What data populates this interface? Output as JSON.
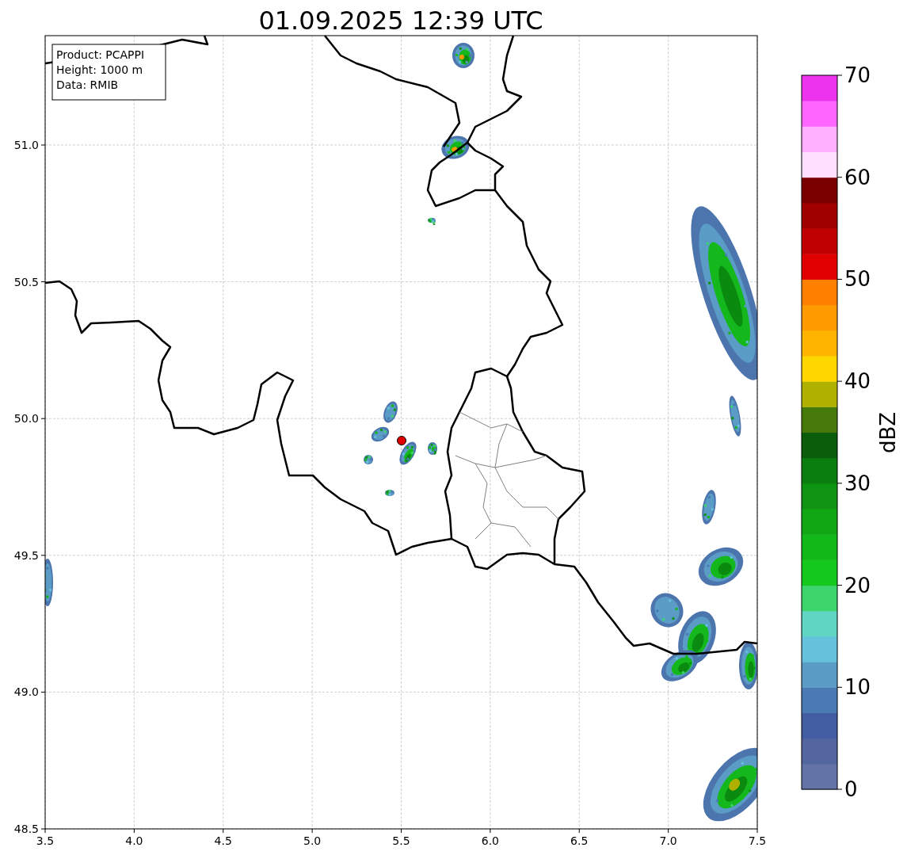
{
  "title": "01.09.2025 12:39 UTC",
  "info_box": [
    "Product: PCAPPI",
    "Height: 1000 m",
    "Data: RMIB"
  ],
  "x_ticks": [
    "3.5",
    "4.0",
    "4.5",
    "5.0",
    "5.5",
    "6.0",
    "6.5",
    "7.0",
    "7.5"
  ],
  "y_ticks": [
    "51.0",
    "50.5",
    "50.0",
    "49.5",
    "49.0",
    "48.5"
  ],
  "colorbar": {
    "label": "dBZ",
    "ticks": [
      "70",
      "60",
      "50",
      "40",
      "30",
      "20",
      "10",
      "0"
    ],
    "levels": [
      {
        "color": "#6373a6"
      },
      {
        "color": "#53669f"
      },
      {
        "color": "#425da2"
      },
      {
        "color": "#4a7ab3"
      },
      {
        "color": "#5a9cc6"
      },
      {
        "color": "#66c2dc"
      },
      {
        "color": "#5fd5c2"
      },
      {
        "color": "#3dd46c"
      },
      {
        "color": "#14c81c"
      },
      {
        "color": "#12b818"
      },
      {
        "color": "#10a614"
      },
      {
        "color": "#0e9312"
      },
      {
        "color": "#0b7e10"
      },
      {
        "color": "#095d0b"
      },
      {
        "color": "#457a0a"
      },
      {
        "color": "#b0b000"
      },
      {
        "color": "#ffd700"
      },
      {
        "color": "#ffb400"
      },
      {
        "color": "#ff9a00"
      },
      {
        "color": "#ff7f00"
      },
      {
        "color": "#e00000"
      },
      {
        "color": "#c00000"
      },
      {
        "color": "#a00000"
      },
      {
        "color": "#7a0000"
      },
      {
        "color": "#ffe0ff"
      },
      {
        "color": "#ffb0ff"
      },
      {
        "color": "#ff66ff"
      },
      {
        "color": "#ee33ee"
      }
    ]
  }
}
